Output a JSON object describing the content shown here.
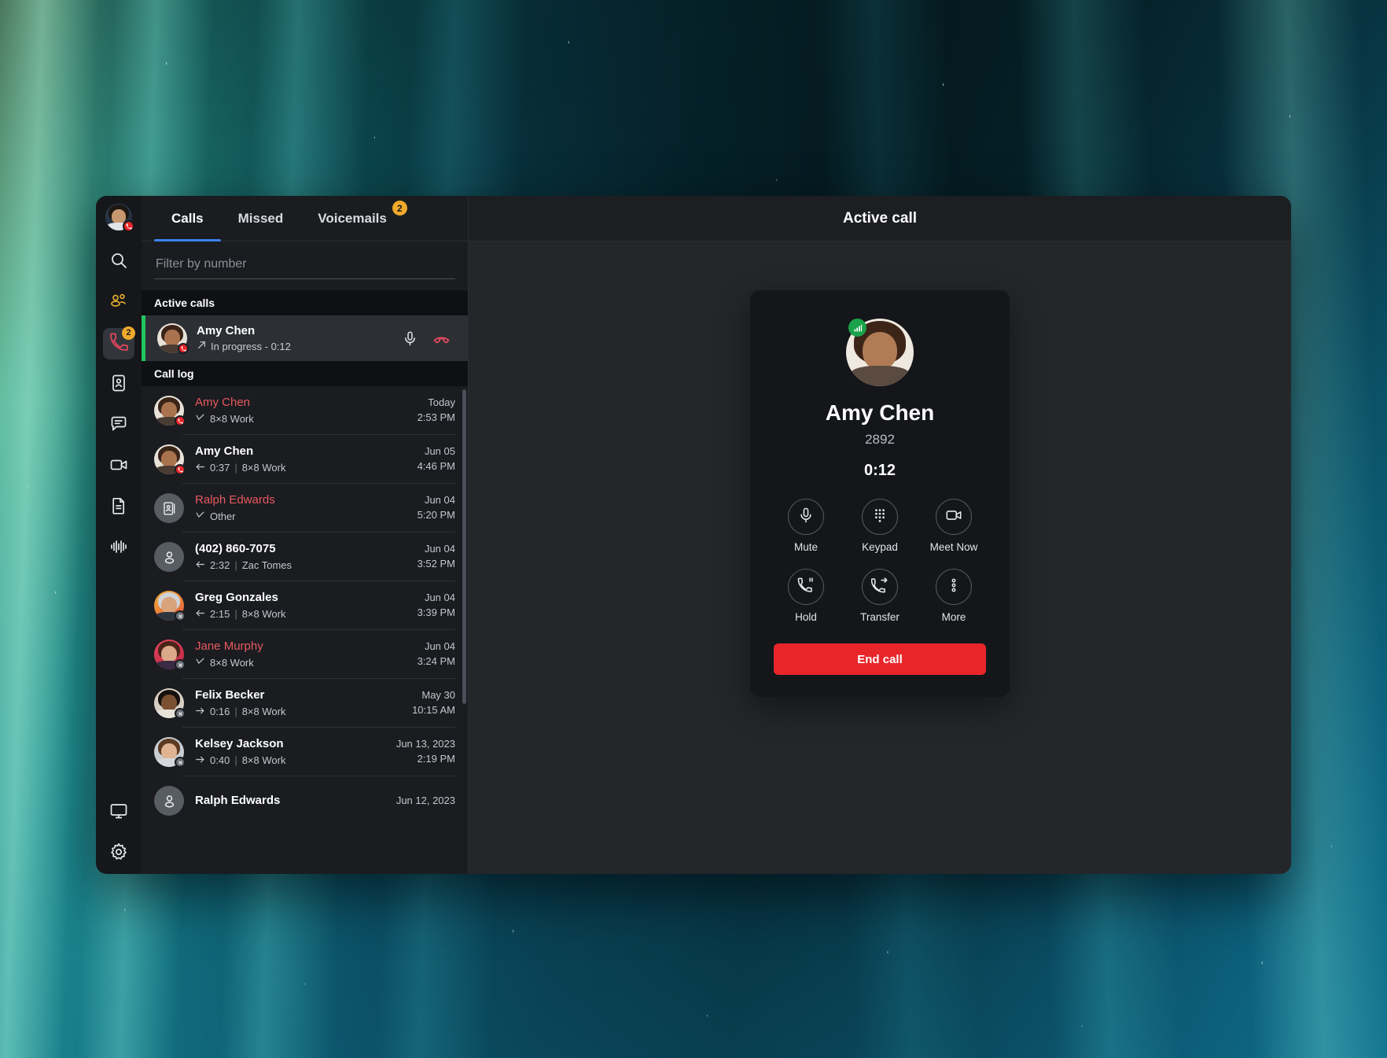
{
  "window": {
    "main_title": "Active call"
  },
  "rail": {
    "avatar_name": "user-avatar",
    "items": [
      {
        "icon": "search-icon",
        "name": "search",
        "badge": null,
        "active": false
      },
      {
        "icon": "contacts-group-icon",
        "name": "contacts-group",
        "badge": null,
        "active": false
      },
      {
        "icon": "phone-icon",
        "name": "calls",
        "badge": "2",
        "active": true
      },
      {
        "icon": "contact-card-icon",
        "name": "contacts",
        "badge": null,
        "active": false
      },
      {
        "icon": "chat-icon",
        "name": "messages",
        "badge": null,
        "active": false
      },
      {
        "icon": "video-icon",
        "name": "meetings",
        "badge": null,
        "active": false
      },
      {
        "icon": "document-icon",
        "name": "files",
        "badge": null,
        "active": false
      },
      {
        "icon": "waveform-icon",
        "name": "recordings",
        "badge": null,
        "active": false
      }
    ],
    "bottom_items": [
      {
        "icon": "monitor-icon",
        "name": "devices"
      },
      {
        "icon": "gear-icon",
        "name": "settings"
      }
    ]
  },
  "tabs": [
    {
      "label": "Calls",
      "badge": null,
      "active": true
    },
    {
      "label": "Missed",
      "badge": null,
      "active": false
    },
    {
      "label": "Voicemails",
      "badge": "2",
      "active": false
    }
  ],
  "filter": {
    "placeholder": "Filter by number",
    "value": ""
  },
  "sections": {
    "active_calls_label": "Active calls",
    "call_log_label": "Call log"
  },
  "active_call_row": {
    "name": "Amy Chen",
    "status": "In progress - 0:12",
    "direction_icon": "outgoing-arrow-icon",
    "mute_icon": "microphone-icon",
    "hangup_icon": "hangup-icon"
  },
  "call_log": [
    {
      "name": "Amy Chen",
      "missed": true,
      "direction_icon": "missed-call-icon",
      "duration": "",
      "line": "8×8 Work",
      "date": "Today",
      "time": "2:53 PM",
      "avatar": "amy",
      "status": "oncall"
    },
    {
      "name": "Amy Chen",
      "missed": false,
      "direction_icon": "incoming-arrow-icon",
      "duration": "0:37",
      "line": "8×8 Work",
      "date": "Jun 05",
      "time": "4:46 PM",
      "avatar": "amy",
      "status": "oncall"
    },
    {
      "name": "Ralph Edwards",
      "missed": true,
      "direction_icon": "missed-call-icon",
      "duration": "",
      "line": "Other",
      "date": "Jun 04",
      "time": "5:20 PM",
      "avatar": "contact-card",
      "status": "none"
    },
    {
      "name": "(402) 860-7075",
      "missed": false,
      "direction_icon": "incoming-arrow-icon",
      "duration": "2:32",
      "line": "Zac Tomes",
      "date": "Jun 04",
      "time": "3:52 PM",
      "avatar": "person",
      "status": "none"
    },
    {
      "name": "Greg Gonzales",
      "missed": false,
      "direction_icon": "incoming-arrow-icon",
      "duration": "2:15",
      "line": "8×8 Work",
      "date": "Jun 04",
      "time": "3:39 PM",
      "avatar": "greg",
      "status": "offline"
    },
    {
      "name": "Jane Murphy",
      "missed": true,
      "direction_icon": "missed-call-icon",
      "duration": "",
      "line": "8×8 Work",
      "date": "Jun 04",
      "time": "3:24 PM",
      "avatar": "jane",
      "status": "offline"
    },
    {
      "name": "Felix Becker",
      "missed": false,
      "direction_icon": "outgoing-arrow-icon",
      "duration": "0:16",
      "line": "8×8 Work",
      "date": "May 30",
      "time": "10:15 AM",
      "avatar": "felix",
      "status": "offline"
    },
    {
      "name": "Kelsey Jackson",
      "missed": false,
      "direction_icon": "outgoing-arrow-icon",
      "duration": "0:40",
      "line": "8×8 Work",
      "date": "Jun 13, 2023",
      "time": "2:19 PM",
      "avatar": "kelsey",
      "status": "offline"
    },
    {
      "name": "Ralph Edwards",
      "missed": false,
      "direction_icon": "",
      "duration": "",
      "line": "",
      "date": "Jun 12, 2023",
      "time": "",
      "avatar": "person",
      "status": "none"
    }
  ],
  "call_card": {
    "name": "Amy Chen",
    "extension": "2892",
    "timer": "0:12",
    "signal_icon": "signal-bars-icon",
    "controls": [
      {
        "label": "Mute",
        "icon": "microphone-icon"
      },
      {
        "label": "Keypad",
        "icon": "dialpad-icon"
      },
      {
        "label": "Meet Now",
        "icon": "video-camera-icon"
      },
      {
        "label": "Hold",
        "icon": "phone-pause-icon"
      },
      {
        "label": "Transfer",
        "icon": "phone-transfer-icon"
      },
      {
        "label": "More",
        "icon": "more-vertical-icon"
      }
    ],
    "end_call_label": "End call"
  },
  "colors": {
    "accent_blue": "#3b82f6",
    "badge_amber": "#f0a92a",
    "danger_red": "#e8262a",
    "missed_red": "#e8595e",
    "active_green": "#22c55e",
    "signal_green": "#1aa34a"
  }
}
